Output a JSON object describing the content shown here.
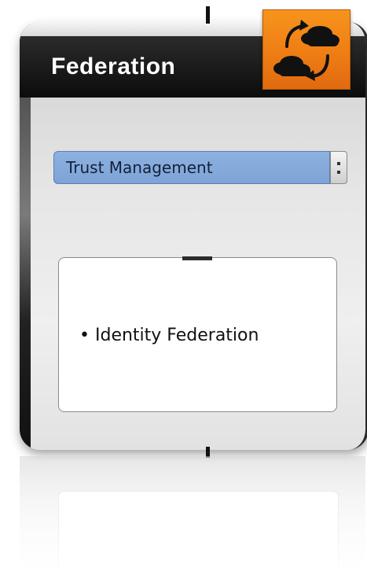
{
  "header": {
    "title": "Federation"
  },
  "logo": {
    "icon": "cloud-sync-icon",
    "colors": {
      "background": "#f7941d",
      "glyph": "#111111"
    }
  },
  "selector": {
    "selected_label": "Trust Management",
    "color": "#8db1e0"
  },
  "content": {
    "bullets": [
      "Identity Federation"
    ]
  }
}
